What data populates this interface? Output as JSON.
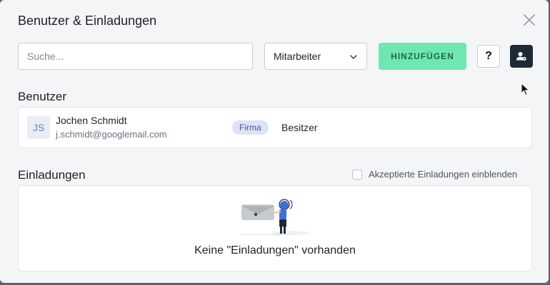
{
  "dialog": {
    "title": "Benutzer & Einladungen"
  },
  "toolbar": {
    "search_placeholder": "Suche...",
    "role_select_value": "Mitarbeiter",
    "add_label": "HINZUFÜGEN",
    "help_label": "?"
  },
  "users": {
    "heading": "Benutzer",
    "items": [
      {
        "initials": "JS",
        "name": "Jochen Schmidt",
        "email": "j.schmidt@googlemail.com",
        "badge": "Firma",
        "role": "Besitzer"
      }
    ]
  },
  "invites": {
    "heading": "Einladungen",
    "show_accepted_label": "Akzeptierte Einladungen einblenden",
    "show_accepted_checked": false,
    "empty_text": "Keine \"Einladungen\" vorhanden"
  },
  "colors": {
    "accent_green": "#6ee7b0",
    "dark_button": "#1f2a37",
    "avatar_bg": "#e8edf6",
    "badge_bg": "#dde3f5"
  },
  "icons": {
    "close": "close-icon",
    "chevron": "chevron-down-icon",
    "user_settings": "user-settings-icon",
    "empty_state": "empty-invites-illustration"
  }
}
